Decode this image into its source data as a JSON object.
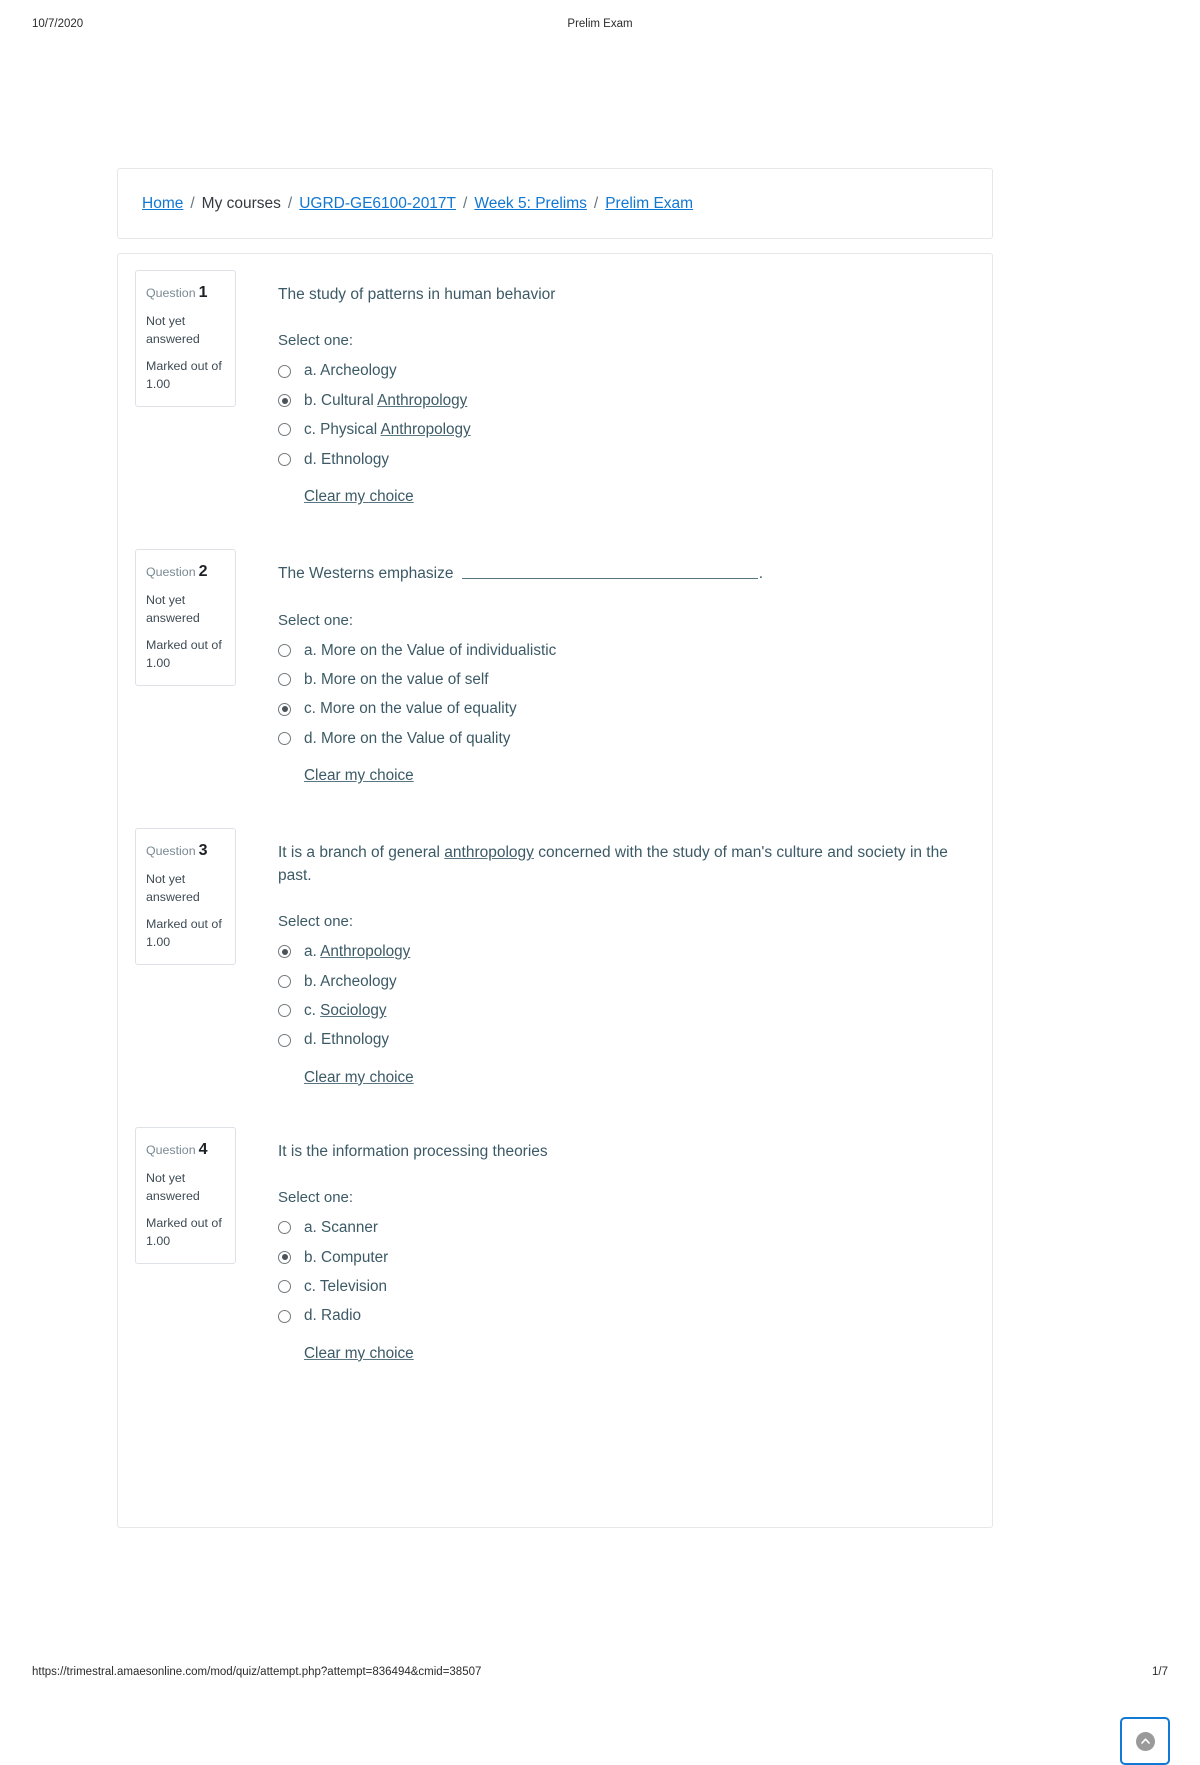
{
  "print": {
    "date": "10/7/2020",
    "doc_title": "Prelim Exam",
    "url": "https://trimestral.amaesonline.com/mod/quiz/attempt.php?attempt=836494&cmid=38507",
    "page_indicator": "1/7"
  },
  "breadcrumb": {
    "separator": "/",
    "items": [
      {
        "label": "Home",
        "link": true
      },
      {
        "label": "My courses",
        "link": false
      },
      {
        "label": "UGRD-GE6100-2017T",
        "link": true
      },
      {
        "label": "Week 5: Prelims",
        "link": true
      },
      {
        "label": "Prelim Exam",
        "link": true
      }
    ]
  },
  "labels": {
    "question_word": "Question",
    "select_one": "Select one:",
    "clear_choice": "Clear my choice",
    "not_answered": "Not yet answered",
    "marked_out_of": "Marked out of",
    "marks": "1.00"
  },
  "colors": {
    "link_blue": "#1177d1",
    "question_text": "#3c5a66",
    "border_grey": "#e6e7e9",
    "accent_button_border": "#1279d4"
  },
  "questions": [
    {
      "number": "1",
      "state": "Not yet answered",
      "marked_out_of": "Marked out of",
      "marks": "1.00",
      "text_before": "The study of patterns in human behavior",
      "text_spell": "",
      "text_after": "",
      "has_blank": false,
      "options": [
        {
          "letter": "a.",
          "text": "Archeology",
          "spell": "",
          "text_tail": "",
          "checked": false
        },
        {
          "letter": "b.",
          "text": "Cultural ",
          "spell": "Anthropology",
          "text_tail": "",
          "checked": true
        },
        {
          "letter": "c.",
          "text": "Physical ",
          "spell": "Anthropology",
          "text_tail": "",
          "checked": false
        },
        {
          "letter": "d.",
          "text": "Ethnology",
          "spell": "",
          "text_tail": "",
          "checked": false
        }
      ]
    },
    {
      "number": "2",
      "state": "Not yet answered",
      "marked_out_of": "Marked out of",
      "marks": "1.00",
      "text_before": "The Westerns emphasize ",
      "text_spell": "",
      "text_after": ".",
      "has_blank": true,
      "options": [
        {
          "letter": "a.",
          "text": "More on the Value of individualistic",
          "spell": "",
          "text_tail": "",
          "checked": false
        },
        {
          "letter": "b.",
          "text": "More on the value of self",
          "spell": "",
          "text_tail": "",
          "checked": false
        },
        {
          "letter": "c.",
          "text": "More on the value of equality",
          "spell": "",
          "text_tail": "",
          "checked": true
        },
        {
          "letter": "d.",
          "text": "More on the Value of quality",
          "spell": "",
          "text_tail": "",
          "checked": false
        }
      ]
    },
    {
      "number": "3",
      "state": "Not yet answered",
      "marked_out_of": "Marked out of",
      "marks": "1.00",
      "text_before": "It is a branch of general ",
      "text_spell": "anthropology",
      "text_after": " concerned with the study of man's culture and society in the past.",
      "has_blank": false,
      "options": [
        {
          "letter": "a.",
          "text": "",
          "spell": "Anthropology",
          "text_tail": "",
          "checked": true
        },
        {
          "letter": "b.",
          "text": "Archeology",
          "spell": "",
          "text_tail": "",
          "checked": false
        },
        {
          "letter": "c.",
          "text": "",
          "spell": "Sociology",
          "text_tail": "",
          "checked": false
        },
        {
          "letter": "d.",
          "text": "Ethnology",
          "spell": "",
          "text_tail": "",
          "checked": false
        }
      ]
    },
    {
      "number": "4",
      "state": "Not yet answered",
      "marked_out_of": "Marked out of",
      "marks": "1.00",
      "text_before": "It is the information processing theories",
      "text_spell": "",
      "text_after": "",
      "has_blank": false,
      "options": [
        {
          "letter": "a.",
          "text": "Scanner",
          "spell": "",
          "text_tail": "",
          "checked": false
        },
        {
          "letter": "b.",
          "text": "Computer",
          "spell": "",
          "text_tail": "",
          "checked": true
        },
        {
          "letter": "c.",
          "text": "Television",
          "spell": "",
          "text_tail": "",
          "checked": false
        },
        {
          "letter": "d.",
          "text": "Radio",
          "spell": "",
          "text_tail": "",
          "checked": false
        }
      ]
    }
  ]
}
